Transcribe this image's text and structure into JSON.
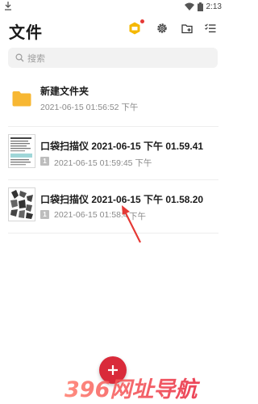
{
  "status": {
    "time": "2:13"
  },
  "header": {
    "title": "文件"
  },
  "search": {
    "placeholder": "搜索"
  },
  "items": [
    {
      "title": "新建文件夹",
      "date": "2021-06-15 01:56:52 下午"
    },
    {
      "title": "口袋扫描仪 2021-06-15 下午 01.59.41",
      "date": "2021-06-15 01:59:45 下午",
      "pages": "1"
    },
    {
      "title": "口袋扫描仪 2021-06-15 下午 01.58.20",
      "date": "2021-06-15 01:58:4",
      "date_tail": "下午",
      "pages": "1"
    }
  ],
  "watermark": {
    "text": "396网址导航"
  },
  "colors": {
    "folder": "#f7b733",
    "accent": "#d92a3a",
    "arrow": "#e53935",
    "vip": "#f5b800"
  }
}
